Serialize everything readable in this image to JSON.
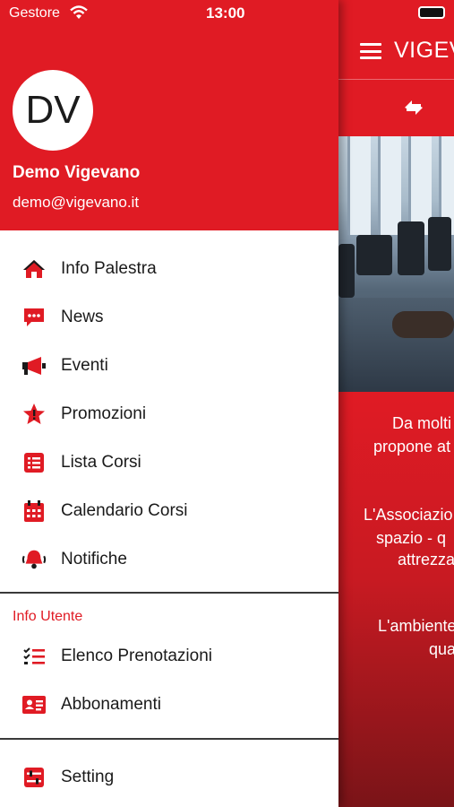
{
  "status_bar": {
    "carrier": "Gestore",
    "time": "13:00"
  },
  "user": {
    "initials": "DV",
    "name": "Demo Vigevano",
    "email": "demo@vigevano.it"
  },
  "menu": [
    {
      "label": "Info Palestra",
      "icon": "home-icon"
    },
    {
      "label": "News",
      "icon": "chat-icon"
    },
    {
      "label": "Eventi",
      "icon": "megaphone-icon"
    },
    {
      "label": "Promozioni",
      "icon": "star-badge-icon"
    },
    {
      "label": "Lista Corsi",
      "icon": "list-icon"
    },
    {
      "label": "Calendario Corsi",
      "icon": "calendar-icon"
    },
    {
      "label": "Notifiche",
      "icon": "bell-icon"
    }
  ],
  "user_section": {
    "title": "Info Utente",
    "items": [
      {
        "label": "Elenco Prenotazioni",
        "icon": "checklist-icon"
      },
      {
        "label": "Abbonamenti",
        "icon": "id-card-icon"
      }
    ]
  },
  "settings": {
    "label": "Setting",
    "icon": "settings-icon"
  },
  "background_app": {
    "title": "VIGEV",
    "text_lines": [
      "Da molti",
      "propone at",
      "L'Associazio",
      "spazio - q",
      "attrezza",
      "L'ambiente",
      "qua"
    ]
  },
  "colors": {
    "brand_red": "#e01b24",
    "text_dark": "#1a1a1a",
    "white": "#ffffff"
  }
}
